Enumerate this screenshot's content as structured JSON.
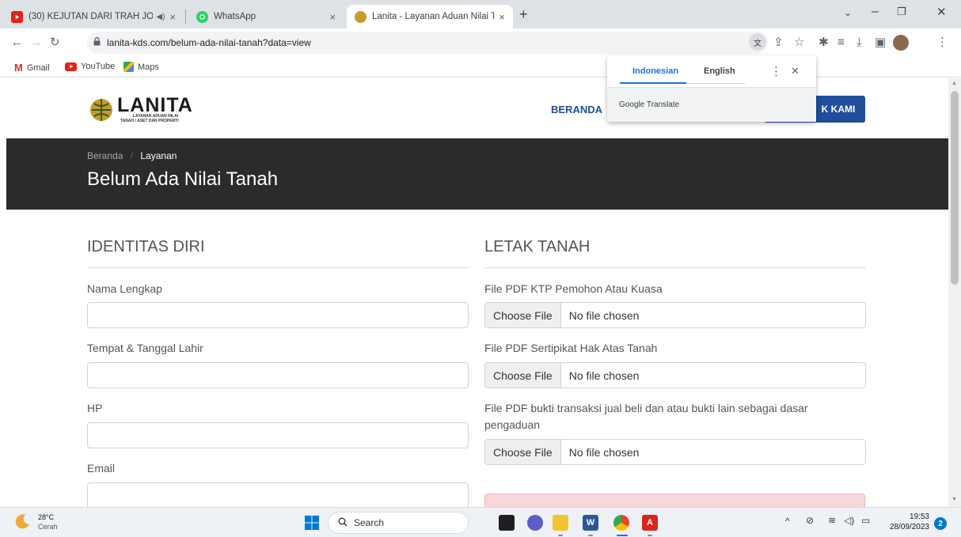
{
  "browser": {
    "tabs": [
      {
        "title": "(30) KEJUTAN DARI TRAH JO",
        "close": "×",
        "active": false
      },
      {
        "title": "WhatsApp",
        "close": "×",
        "active": false
      },
      {
        "title": "Lanita - Layanan Aduan Nilai Tan",
        "close": "×",
        "active": true
      }
    ],
    "new_tab": "+",
    "url": "lanita-kds.com/belum-ada-nilai-tanah?data=view",
    "bookmarks": [
      "Gmail",
      "YouTube",
      "Maps"
    ]
  },
  "translate_popup": {
    "lang_source": "Indonesian",
    "lang_target": "English",
    "provider": "Google Translate",
    "menu": "⋮",
    "close": "✕"
  },
  "site": {
    "logo_text": "LANITA",
    "logo_sub1": "LAYANAN ADUAN NILAI",
    "logo_sub2": "TANAH / ASET DAN PROPERTI",
    "nav_home": "BERANDA",
    "contact_button": "K KAMI",
    "breadcrumb_home": "Beranda",
    "breadcrumb_sep": "/",
    "breadcrumb_current": "Layanan",
    "page_title": "Belum Ada Nilai Tanah"
  },
  "form": {
    "left_section_title": "IDENTITAS DIRI",
    "right_section_title": "LETAK TANAH",
    "fields": {
      "name_label": "Nama Lengkap",
      "birth_label": "Tempat & Tanggal Lahir",
      "phone_label": "HP",
      "email_label": "Email"
    },
    "files": {
      "ktp_label": "File PDF KTP Pemohon Atau Kuasa",
      "cert_label": "File PDF Sertipikat Hak Atas Tanah",
      "trans_label_1": "File PDF bukti transaksi jual beli dan atau bukti lain sebagai dasar",
      "trans_label_2": "pengaduan",
      "choose_file": "Choose File",
      "no_file": "No file chosen"
    }
  },
  "taskbar": {
    "weather_temp": "28°C",
    "weather_desc": "Cerah",
    "search_placeholder": "Search",
    "time": "19:53",
    "date": "28/09/2023",
    "notification_count": "2"
  },
  "colors": {
    "brand_blue": "#1f4e9c",
    "hero_bg": "#2b2b2b",
    "alert_bg": "#f8d7da"
  }
}
